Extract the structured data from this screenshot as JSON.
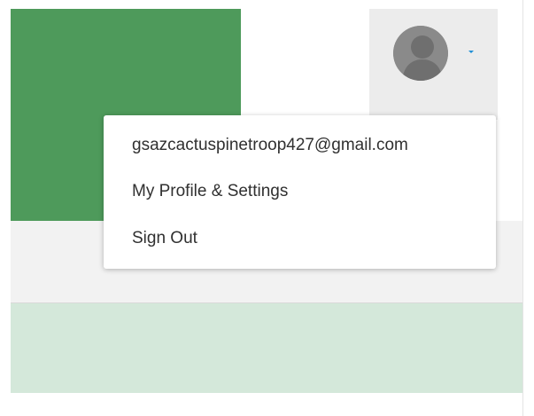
{
  "header": {
    "avatar_icon": "user-avatar-icon",
    "caret_icon": "chevron-down-icon",
    "caret_color": "#1f8fd6"
  },
  "user_menu": {
    "email": "gsazcactuspinetroop427@gmail.com",
    "profile_settings_label": "My Profile & Settings",
    "sign_out_label": "Sign Out"
  },
  "colors": {
    "banner_green": "#4e9a5b",
    "light_green": "#d4e8da",
    "avatar_bg": "#ececec"
  }
}
